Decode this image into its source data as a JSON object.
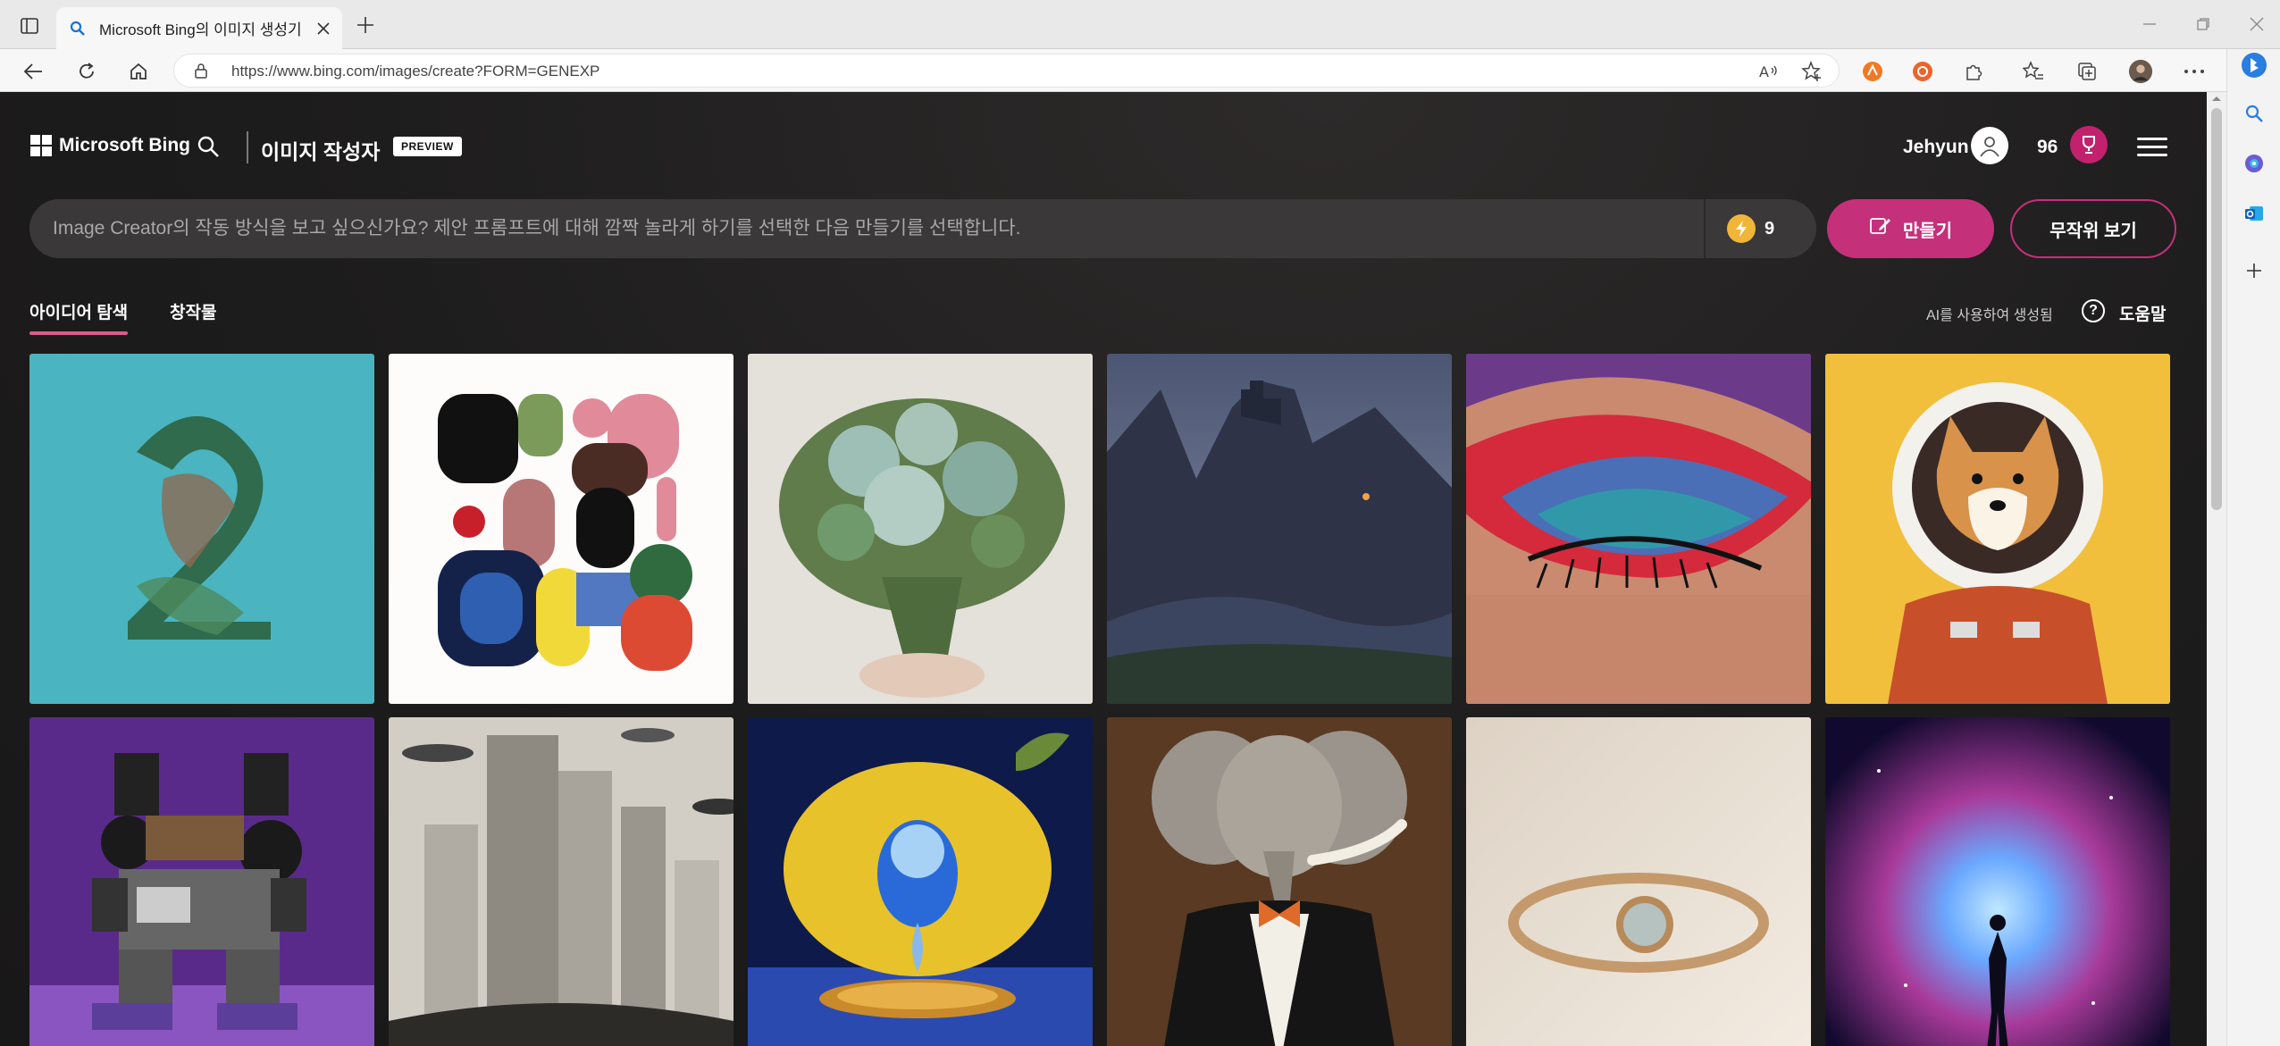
{
  "browser": {
    "tab_title": "Microsoft Bing의 이미지 생성기",
    "url": "https://www.bing.com/images/create?FORM=GENEXP"
  },
  "header": {
    "brand": "Microsoft Bing",
    "title": "이미지 작성자",
    "badge": "PREVIEW",
    "user_name": "Jehyun",
    "points": "96"
  },
  "prompt": {
    "placeholder": "Image Creator의 작동 방식을 보고 싶으신가요? 제안 프롬프트에 대해 깜짝 놀라게 하기를 선택한 다음 만들기를 선택합니다.",
    "boosts": "9",
    "create_label": "만들기",
    "surprise_label": "무작위 보기"
  },
  "tabs": [
    {
      "label": "아이디어 탐색",
      "active": true
    },
    {
      "label": "창작물",
      "active": false
    }
  ],
  "ai_note": "AI를 사용하여 생성됨",
  "help_label": "도움말",
  "help_icon_glyph": "?",
  "gallery": [
    {
      "name": "tile-number-two",
      "icon": "number-two-leaves-image"
    },
    {
      "name": "tile-abstract-shapes",
      "icon": "abstract-shapes-image"
    },
    {
      "name": "tile-succulent-bouquet",
      "icon": "succulent-bouquet-image"
    },
    {
      "name": "tile-dark-castle",
      "icon": "mountain-castle-image"
    },
    {
      "name": "tile-eye-makeup",
      "icon": "eye-makeup-image"
    },
    {
      "name": "tile-shiba-astronaut",
      "icon": "shiba-astronaut-image"
    },
    {
      "name": "tile-purple-robot",
      "icon": "robot-image"
    },
    {
      "name": "tile-city-spaceships",
      "icon": "city-spaceships-image"
    },
    {
      "name": "tile-lemon-drop",
      "icon": "lemon-drop-image"
    },
    {
      "name": "tile-elephant-tuxedo",
      "icon": "elephant-tuxedo-image"
    },
    {
      "name": "tile-gold-ring",
      "icon": "gold-ring-image"
    },
    {
      "name": "tile-cosmic-nebula",
      "icon": "nebula-image"
    }
  ],
  "colors": {
    "accent": "#c5307b",
    "page_bg": "#1d1c1c",
    "prompt_bg": "#3a3838",
    "boost": "#f0b63a"
  }
}
